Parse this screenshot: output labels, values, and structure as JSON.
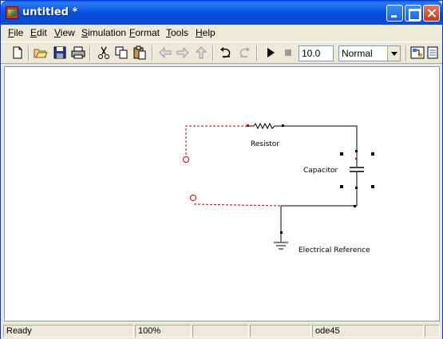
{
  "window": {
    "title": "untitled *"
  },
  "menu": {
    "items": [
      {
        "label": "File",
        "hotkey": "F",
        "rest": "ile"
      },
      {
        "label": "Edit",
        "hotkey": "E",
        "rest": "dit"
      },
      {
        "label": "View",
        "hotkey": "V",
        "rest": "iew"
      },
      {
        "label": "Simulation",
        "hotkey": "S",
        "rest": "imulation"
      },
      {
        "label": "Format",
        "hotkey": "F",
        "rest": "ormat"
      },
      {
        "label": "Tools",
        "hotkey": "T",
        "rest": "ools"
      },
      {
        "label": "Help",
        "hotkey": "H",
        "rest": "elp"
      }
    ]
  },
  "toolbar": {
    "stop_time": "10.0",
    "sim_mode": "Normal",
    "icons": [
      "new-icon",
      "open-icon",
      "save-icon",
      "print-icon",
      "cut-icon",
      "copy-icon",
      "paste-icon",
      "back-icon",
      "forward-icon",
      "up-icon",
      "undo-icon",
      "redo-icon",
      "start-icon",
      "stop-icon",
      "library-browser-icon",
      "model-explorer-icon"
    ]
  },
  "model": {
    "blocks": {
      "resistor": "Resistor",
      "capacitor": "Capacitor",
      "reference": "Electrical Reference"
    }
  },
  "status": {
    "state": "Ready",
    "zoom": "100%",
    "cell3": "",
    "cell4": "",
    "solver": "ode45",
    "cell6": ""
  },
  "colors": {
    "title_bar": "#0854e3",
    "unconnected_line": "#cc0000",
    "port": "#cc0000"
  }
}
